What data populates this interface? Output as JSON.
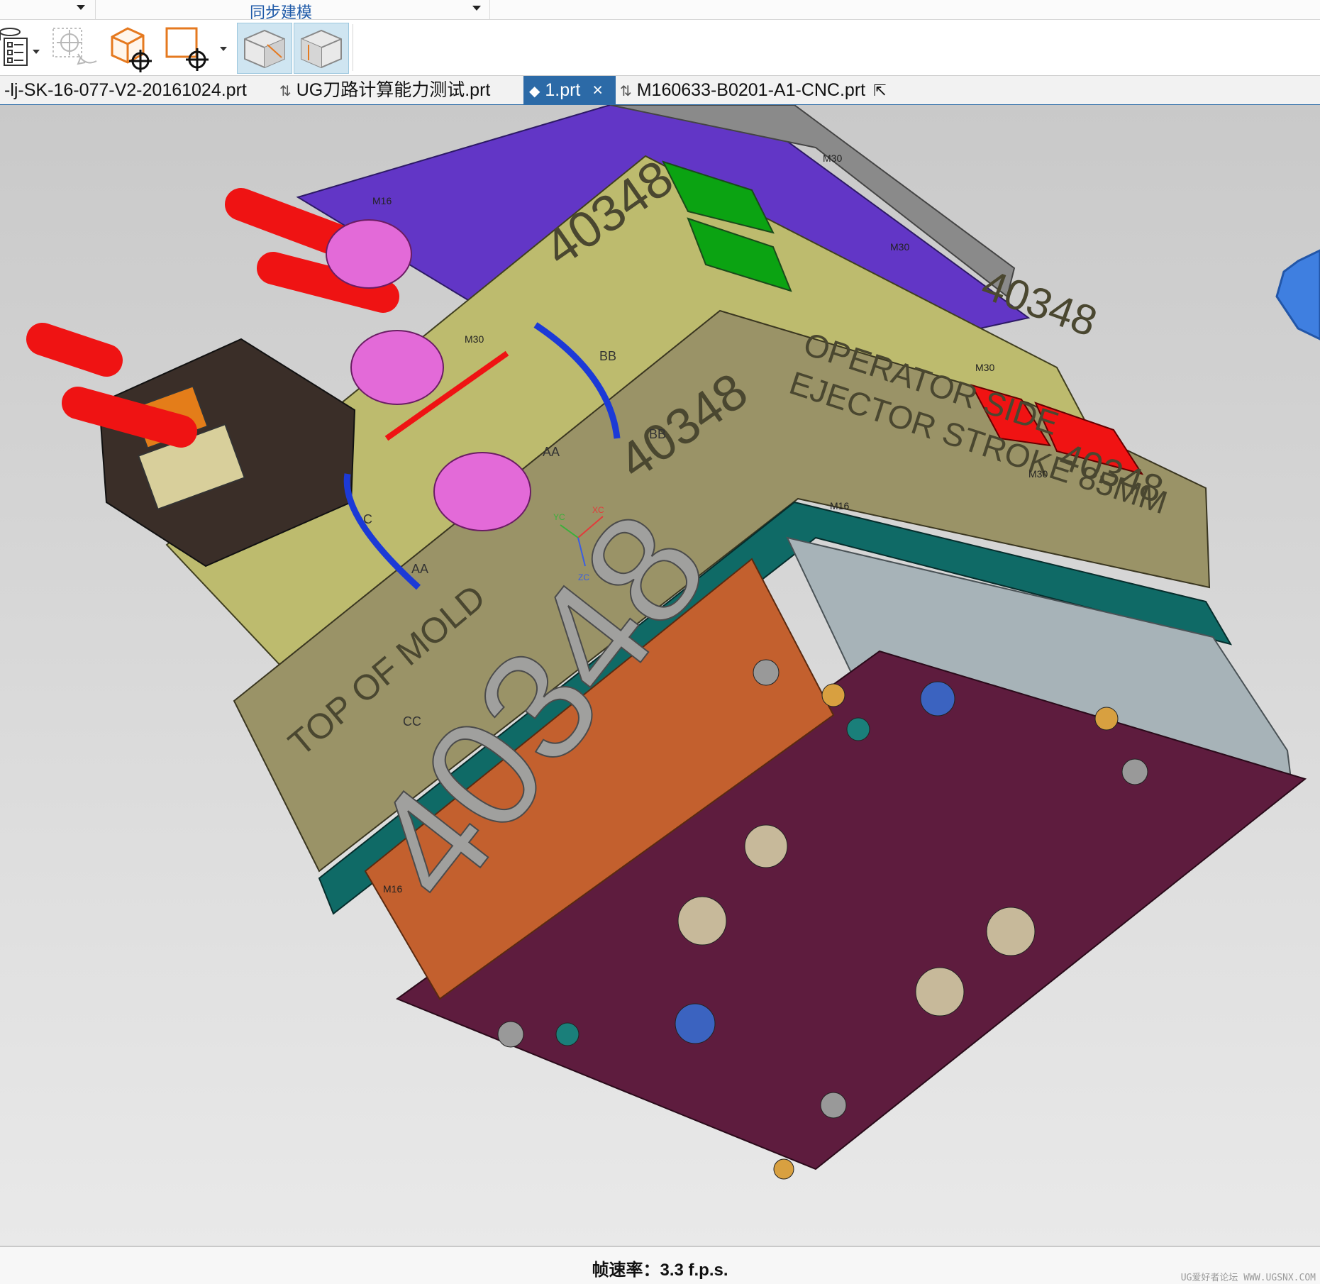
{
  "ribbon": {
    "group_label": "同步建模"
  },
  "toolbar": {
    "buttons": [
      {
        "icon": "list-checklist-icon"
      },
      {
        "icon": "csys-disabled-icon"
      },
      {
        "icon": "wcs-box-origin-icon"
      },
      {
        "icon": "sketch-origin-icon"
      },
      {
        "icon": "shaded-solid-icon"
      },
      {
        "icon": "static-wireframe-icon"
      }
    ]
  },
  "tabs": [
    {
      "label": "-lj-SK-16-077-V2-20161024.prt",
      "active": false
    },
    {
      "label": "UG刀路计算能力测试.prt",
      "active": false
    },
    {
      "label": "1.prt",
      "active": true,
      "close": "×"
    },
    {
      "label": "M160633-B0201-A1-CNC.prt",
      "active": false
    }
  ],
  "model": {
    "mold_number": "40348",
    "small_labels": [
      "40348",
      "40348",
      "40348",
      "40348"
    ],
    "operator_side": "OPERATOR SIDE",
    "ejector_stroke": "EJECTOR STROKE 85MM",
    "top_of_mold": "TOP OF MOLD",
    "hose_labels": [
      "AA",
      "AA",
      "BB",
      "BB",
      "CC",
      "C"
    ],
    "thread_labels": [
      "M30",
      "M30",
      "M30",
      "M30",
      "M30",
      "M16",
      "M16",
      "M16"
    ],
    "axis_labels": [
      "XC",
      "YC",
      "ZC"
    ]
  },
  "colors": {
    "tab_active": "#2c6aa7",
    "clamp_plate": "#5e1c3e",
    "name_plate": "#c3602e",
    "plate_khaki": "#9a9367",
    "plate_olive": "#bdbb6e",
    "plate_purple": "#6236c6",
    "plate_teal": "#0f6a66",
    "hose_red": "#ef1313",
    "hose_blue": "#1c3ad6",
    "clamp_pink": "#e36ad8"
  },
  "status": {
    "frame_rate": "帧速率：3.3 f.p.s."
  },
  "watermark": "UG爱好者论坛 WWW.UGSNX.COM"
}
